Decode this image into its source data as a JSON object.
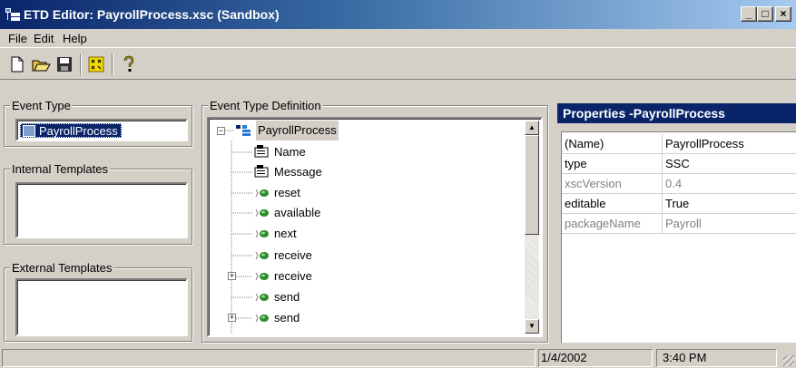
{
  "window": {
    "title": "ETD Editor: PayrollProcess.xsc (Sandbox)",
    "minimize": "_",
    "maximize": "□",
    "close": "×"
  },
  "menu": {
    "items": [
      "File",
      "Edit",
      "Help"
    ]
  },
  "toolbar": {
    "buttons": [
      "new-document-icon",
      "open-folder-icon",
      "save-disk-icon",
      "compile-icon",
      "help-icon"
    ]
  },
  "event_type": {
    "label": "Event Type",
    "value": "PayrollProcess"
  },
  "internal_templates": {
    "label": "Internal Templates"
  },
  "external_templates": {
    "label": "External Templates"
  },
  "definition": {
    "label": "Event Type Definition",
    "root": "PayrollProcess",
    "nodes": [
      {
        "label": "Name",
        "icon": "field-icon",
        "expandable": false
      },
      {
        "label": "Message",
        "icon": "field-icon",
        "expandable": false
      },
      {
        "label": "reset",
        "icon": "method-icon",
        "expandable": false
      },
      {
        "label": "available",
        "icon": "method-icon",
        "expandable": false
      },
      {
        "label": "next",
        "icon": "method-icon",
        "expandable": false
      },
      {
        "label": "receive",
        "icon": "method-icon",
        "expandable": false
      },
      {
        "label": "receive",
        "icon": "method-icon",
        "expandable": true
      },
      {
        "label": "send",
        "icon": "method-icon",
        "expandable": false
      },
      {
        "label": "send",
        "icon": "method-icon",
        "expandable": true
      }
    ]
  },
  "properties": {
    "header": "Properties -PayrollProcess",
    "rows": [
      {
        "name": "(Name)",
        "value": "PayrollProcess",
        "readonly": false
      },
      {
        "name": "type",
        "value": "SSC",
        "readonly": false
      },
      {
        "name": "xscVersion",
        "value": "0.4",
        "readonly": true
      },
      {
        "name": "editable",
        "value": "True",
        "readonly": false
      },
      {
        "name": "packageName",
        "value": "Payroll",
        "readonly": true
      }
    ]
  },
  "status": {
    "message": "",
    "date": "1/4/2002",
    "time": "3:40 PM"
  },
  "colors": {
    "title_bar": "#0a246a",
    "selection": "#0a246a",
    "method_icon": "#2e8b2e",
    "face": "#d4d0c8"
  }
}
